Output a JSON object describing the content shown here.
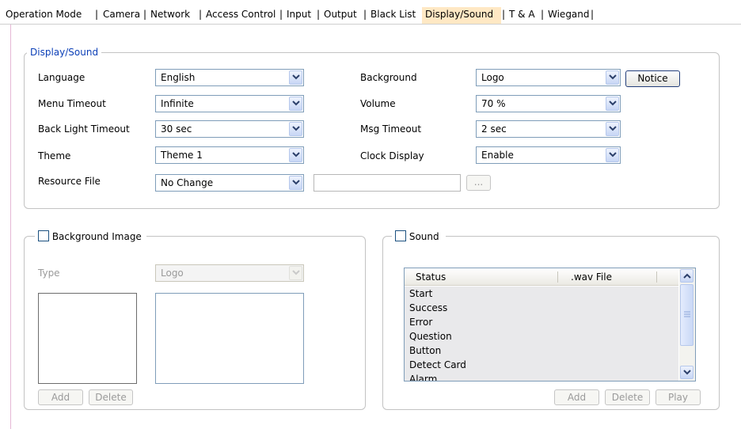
{
  "tabs": [
    {
      "label": "Operation Mode",
      "active": false
    },
    {
      "label": "Camera",
      "active": false
    },
    {
      "label": "Network",
      "active": false
    },
    {
      "label": "Access Control",
      "active": false
    },
    {
      "label": "Input",
      "active": false
    },
    {
      "label": "Output",
      "active": false
    },
    {
      "label": "Black List",
      "active": false
    },
    {
      "label": "Display/Sound",
      "active": true
    },
    {
      "label": "T & A",
      "active": false
    },
    {
      "label": "Wiegand",
      "active": false
    }
  ],
  "tab_separator": "|",
  "display_sound": {
    "legend": "Display/Sound",
    "language": {
      "label": "Language",
      "value": "English"
    },
    "menu_timeout": {
      "label": "Menu Timeout",
      "value": "Infinite"
    },
    "back_light_timeout": {
      "label": "Back Light Timeout",
      "value": "30 sec"
    },
    "theme": {
      "label": "Theme",
      "value": "Theme 1"
    },
    "resource_file": {
      "label": "Resource File",
      "value": "No Change",
      "path": "",
      "browse_label": "..."
    },
    "background": {
      "label": "Background",
      "value": "Logo",
      "notice_label": "Notice"
    },
    "volume": {
      "label": "Volume",
      "value": "70 %"
    },
    "msg_timeout": {
      "label": "Msg Timeout",
      "value": "2 sec"
    },
    "clock_display": {
      "label": "Clock Display",
      "value": "Enable"
    }
  },
  "background_image": {
    "legend": "Background Image",
    "checked": false,
    "type_label": "Type",
    "type_value": "Logo",
    "add_label": "Add",
    "delete_label": "Delete"
  },
  "sound": {
    "legend": "Sound",
    "checked": false,
    "columns": [
      "Status",
      ".wav File"
    ],
    "items": [
      "Start",
      "Success",
      "Error",
      "Question",
      "Button",
      "Detect Card",
      "Alarm"
    ],
    "add_label": "Add",
    "delete_label": "Delete",
    "play_label": "Play"
  },
  "colors": {
    "legend_blue": "#0b3fb7",
    "active_tab": "#ffe8c4",
    "list_body": "#e9e9eb"
  },
  "icons": [
    "chevron-down-icon",
    "chevron-up-icon",
    "scroll-grip-icon",
    "checkbox-icon"
  ]
}
